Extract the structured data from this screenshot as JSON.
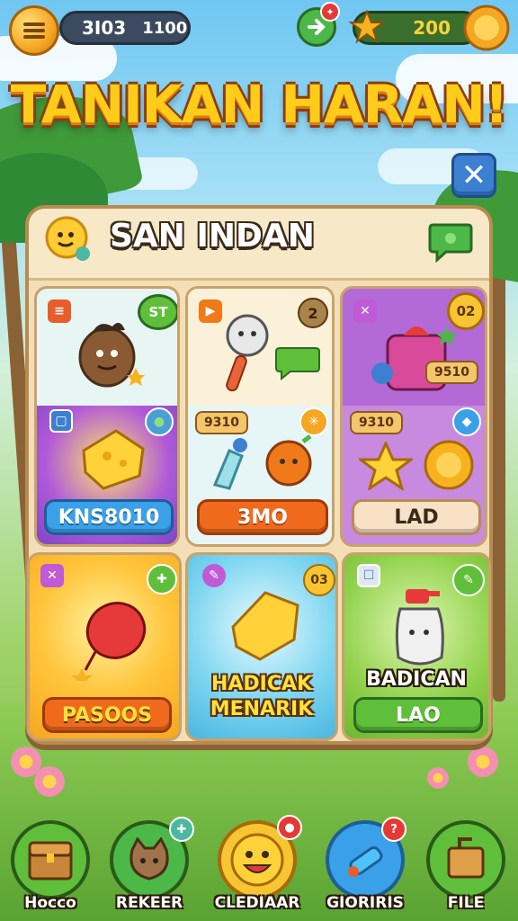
{
  "hud": {
    "left_value_1": "3I03",
    "left_value_2": "1100",
    "right_value": "200"
  },
  "title": "TANIKAN HARAN!",
  "panel": {
    "header_title": "SAN INDAN",
    "cards": [
      {
        "top_badge": "ST",
        "button": "KNS8010"
      },
      {
        "top_badge": "2",
        "side_tag": "9310",
        "button": "3MO"
      },
      {
        "top_badge": "02",
        "tag_1": "9510",
        "tag_2": "9310",
        "button": "LAD"
      },
      {
        "button": "PASOOS"
      },
      {
        "top_badge": "03",
        "label": "HADICAK MENARIK"
      },
      {
        "label": "BADICAN",
        "button": "LAO"
      }
    ]
  },
  "nav": [
    {
      "label": "Hocco"
    },
    {
      "label": "REKEER"
    },
    {
      "label": "CLEDIAAR"
    },
    {
      "label": "GIORIRIS"
    },
    {
      "label": "FILE"
    }
  ],
  "colors": {
    "title_yellow": "#ffcc1a",
    "panel_bg": "#f3dfb7",
    "accent_green": "#5fbf3a",
    "accent_blue": "#3d7fd0",
    "accent_orange": "#f07a1a"
  }
}
